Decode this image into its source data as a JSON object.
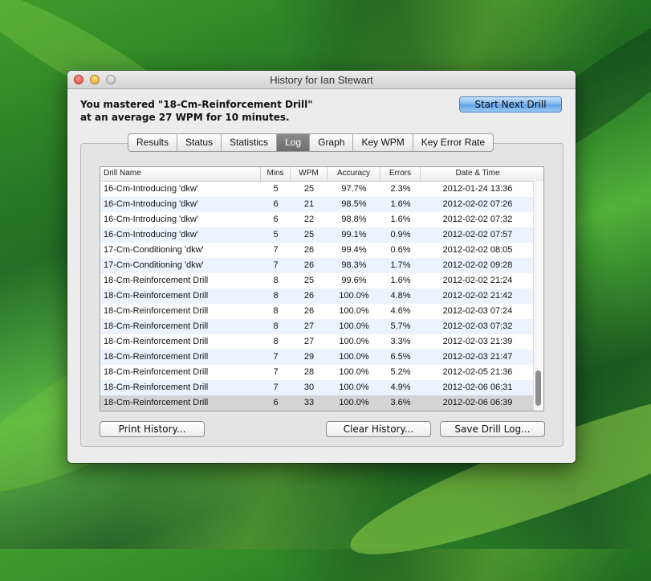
{
  "window": {
    "title": "History for Ian Stewart",
    "message_line1": "You mastered \"18-Cm-Reinforcement Drill\"",
    "message_line2": "at an average 27 WPM for 10 minutes.",
    "start_next_drill_label": "Start Next Drill"
  },
  "tabs": [
    {
      "label": "Results"
    },
    {
      "label": "Status"
    },
    {
      "label": "Statistics"
    },
    {
      "label": "Log",
      "active": true
    },
    {
      "label": "Graph"
    },
    {
      "label": "Key WPM"
    },
    {
      "label": "Key Error Rate"
    }
  ],
  "table": {
    "columns": [
      "Drill Name",
      "Mins",
      "WPM",
      "Accuracy",
      "Errors",
      "Date & Time"
    ],
    "rows": [
      [
        "16-Cm-Introducing 'dkw'",
        "5",
        "25",
        "97.7%",
        "2.3%",
        "2012-01-24 13:36"
      ],
      [
        "16-Cm-Introducing 'dkw'",
        "6",
        "21",
        "98.5%",
        "1.6%",
        "2012-02-02 07:26"
      ],
      [
        "16-Cm-Introducing 'dkw'",
        "6",
        "22",
        "98.8%",
        "1.6%",
        "2012-02-02 07:32"
      ],
      [
        "16-Cm-Introducing 'dkw'",
        "5",
        "25",
        "99.1%",
        "0.9%",
        "2012-02-02 07:57"
      ],
      [
        "17-Cm-Conditioning 'dkw'",
        "7",
        "26",
        "99.4%",
        "0.6%",
        "2012-02-02 08:05"
      ],
      [
        "17-Cm-Conditioning 'dkw'",
        "7",
        "26",
        "98.3%",
        "1.7%",
        "2012-02-02 09:28"
      ],
      [
        "18-Cm-Reinforcement Drill",
        "8",
        "25",
        "99.6%",
        "1.6%",
        "2012-02-02 21:24"
      ],
      [
        "18-Cm-Reinforcement Drill",
        "8",
        "26",
        "100.0%",
        "4.8%",
        "2012-02-02 21:42"
      ],
      [
        "18-Cm-Reinforcement Drill",
        "8",
        "26",
        "100.0%",
        "4.6%",
        "2012-02-03 07:24"
      ],
      [
        "18-Cm-Reinforcement Drill",
        "8",
        "27",
        "100.0%",
        "5.7%",
        "2012-02-03 07:32"
      ],
      [
        "18-Cm-Reinforcement Drill",
        "8",
        "27",
        "100.0%",
        "3.3%",
        "2012-02-03 21:39"
      ],
      [
        "18-Cm-Reinforcement Drill",
        "7",
        "29",
        "100.0%",
        "6.5%",
        "2012-02-03 21:47"
      ],
      [
        "18-Cm-Reinforcement Drill",
        "7",
        "28",
        "100.0%",
        "5.2%",
        "2012-02-05 21:36"
      ],
      [
        "18-Cm-Reinforcement Drill",
        "7",
        "30",
        "100.0%",
        "4.9%",
        "2012-02-06 06:31"
      ],
      [
        "18-Cm-Reinforcement Drill",
        "6",
        "33",
        "100.0%",
        "3.6%",
        "2012-02-06 06:39"
      ]
    ],
    "selected_row": 14
  },
  "buttons": {
    "print_history": "Print History...",
    "clear_history": "Clear History...",
    "save_drill_log": "Save Drill Log..."
  },
  "icons": {
    "close": "close-icon",
    "minimize": "minimize-icon",
    "zoom": "zoom-icon"
  },
  "colors": {
    "selected_row": "#d4d4d4",
    "alt_row": "#edf3fe",
    "active_tab": "#7d7d7d",
    "primary_button": "#6fa9ec"
  }
}
